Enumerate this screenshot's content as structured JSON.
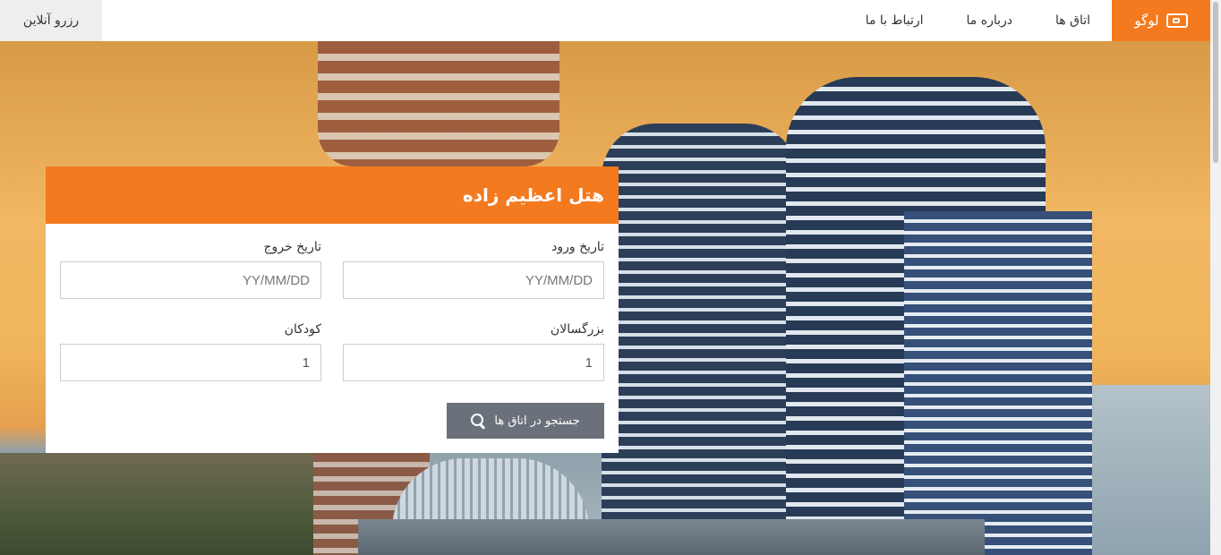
{
  "nav": {
    "online_booking": "رزرو آنلاین",
    "links": [
      "اتاق ها",
      "درباره ما",
      "ارتباط با ما"
    ],
    "logo_label": "لوگو",
    "accent_color": "#f47a1f"
  },
  "booking": {
    "title": "هتل اعظیم زاده",
    "checkin_label": "تاریخ ورود",
    "checkin_placeholder": "YY/MM/DD",
    "checkout_label": "تاریخ خروج",
    "checkout_placeholder": "YY/MM/DD",
    "adults_label": "بزرگسالان",
    "adults_value": "1",
    "children_label": "کودکان",
    "children_value": "1",
    "search_button": "جستجو در اتاق ها",
    "search_icon": "search-icon"
  }
}
